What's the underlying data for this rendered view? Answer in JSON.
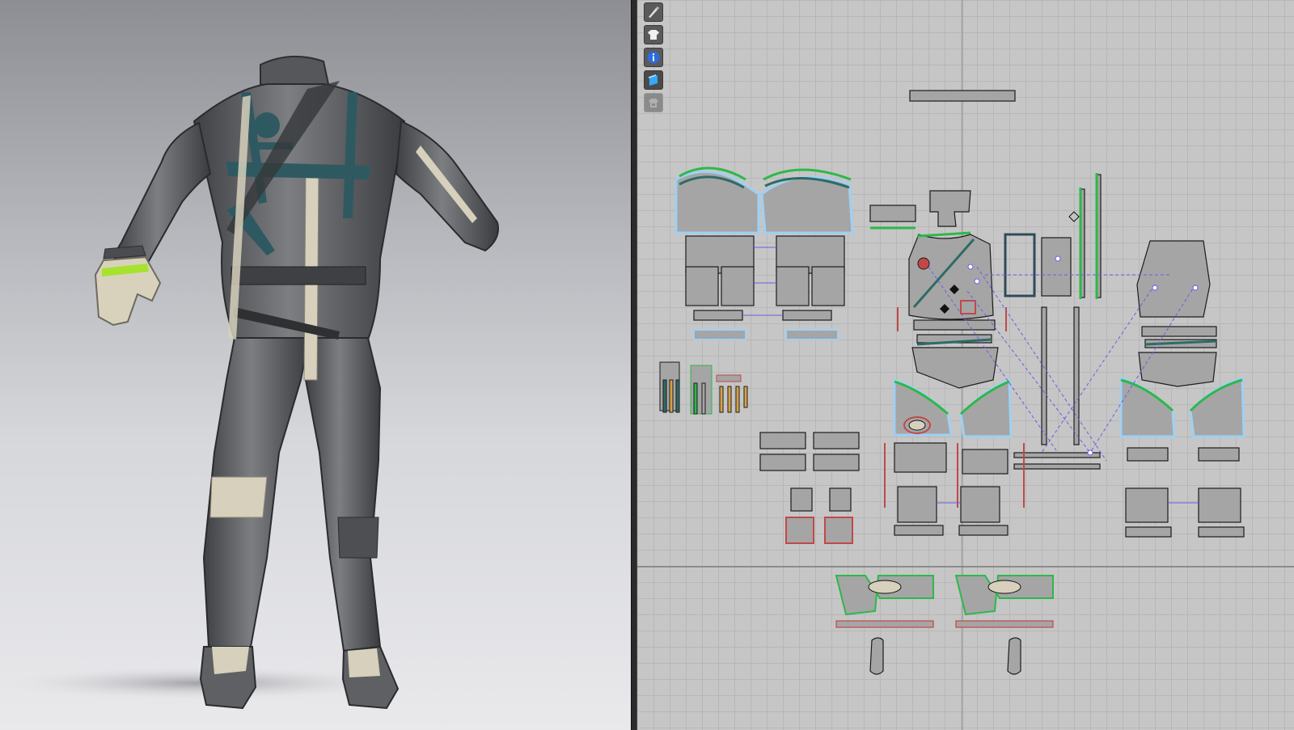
{
  "viewport3d": {
    "background_top": "#8d8e93",
    "background_bottom": "#e9e9ec",
    "suit_color": "#5b5d60",
    "strap_color": "#2f5961",
    "trim_color": "#d6d0bc",
    "accent_color": "#a6e22e"
  },
  "pattern_window": {
    "grid_color": "#b7b7b7",
    "panel_fill": "#a5a5a5",
    "outline_color": "#1c1c1c",
    "highlight_color": "#9fd0f2",
    "seam_green": "#2db84a",
    "seam_teal": "#2f6b66",
    "seam_red": "#c24848",
    "seam_orange": "#d7a24a",
    "sewing_line_color": "#6c5ce7"
  },
  "toolbar": {
    "tools": [
      {
        "icon": "pen-tool-icon",
        "state": "normal"
      },
      {
        "icon": "shirt-avatar-icon",
        "state": "normal"
      },
      {
        "icon": "info-icon",
        "state": "normal"
      },
      {
        "icon": "layers-icon",
        "state": "active"
      },
      {
        "icon": "lock-garment-icon",
        "state": "disabled"
      }
    ]
  }
}
